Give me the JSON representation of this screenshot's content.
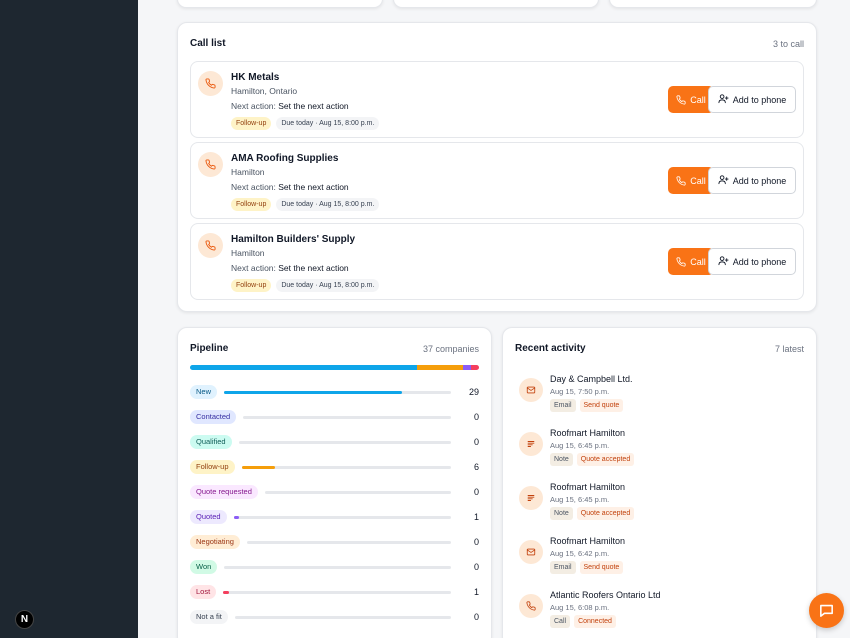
{
  "call_list": {
    "title": "Call list",
    "meta": "3 to call",
    "call_label": "Call",
    "phone_label": "Add to phone",
    "next_prefix": "Next action: ",
    "items": [
      {
        "name": "HK Metals",
        "location": "Hamilton, Ontario",
        "next_action": "Set the next action",
        "tag": "Follow-up",
        "due": "Due today · Aug 15, 8:00 p.m."
      },
      {
        "name": "AMA Roofing Supplies",
        "location": "Hamilton",
        "next_action": "Set the next action",
        "tag": "Follow-up",
        "due": "Due today · Aug 15, 8:00 p.m."
      },
      {
        "name": "Hamilton Builders' Supply",
        "location": "Hamilton",
        "next_action": "Set the next action",
        "tag": "Follow-up",
        "due": "Due today · Aug 15, 8:00 p.m."
      }
    ]
  },
  "pipeline": {
    "title": "Pipeline",
    "meta": "37 companies",
    "total": 37,
    "stages": [
      {
        "label": "New",
        "count": 29,
        "color": "#0ea5e9",
        "bg": "#e0f2fe",
        "fg": "#075985"
      },
      {
        "label": "Contacted",
        "count": 0,
        "color": "#6366f1",
        "bg": "#e0e7ff",
        "fg": "#3730a3"
      },
      {
        "label": "Qualified",
        "count": 0,
        "color": "#14b8a6",
        "bg": "#ccfbf1",
        "fg": "#115e59"
      },
      {
        "label": "Follow-up",
        "count": 6,
        "color": "#f59e0b",
        "bg": "#fef3c7",
        "fg": "#92400e"
      },
      {
        "label": "Quote requested",
        "count": 0,
        "color": "#c026d3",
        "bg": "#fae8ff",
        "fg": "#86198f"
      },
      {
        "label": "Quoted",
        "count": 1,
        "color": "#8b5cf6",
        "bg": "#ede9fe",
        "fg": "#5b21b6"
      },
      {
        "label": "Negotiating",
        "count": 0,
        "color": "#f97316",
        "bg": "#ffedd5",
        "fg": "#9a3412"
      },
      {
        "label": "Won",
        "count": 0,
        "color": "#10b981",
        "bg": "#d1fae5",
        "fg": "#065f46"
      },
      {
        "label": "Lost",
        "count": 1,
        "color": "#f43f5e",
        "bg": "#ffe4e6",
        "fg": "#9f1239"
      },
      {
        "label": "Not a fit",
        "count": 0,
        "color": "#9ca3af",
        "bg": "#f3f4f6",
        "fg": "#374151"
      }
    ]
  },
  "recent_activity": {
    "title": "Recent activity",
    "meta": "7 latest",
    "items": [
      {
        "name": "Day & Campbell Ltd.",
        "time": "Aug 15, 7:50 p.m.",
        "type": "Email",
        "result": "Send quote",
        "icon": "mail-icon"
      },
      {
        "name": "Roofmart Hamilton",
        "time": "Aug 15, 6:45 p.m.",
        "type": "Note",
        "result": "Quote accepted",
        "icon": "note-icon"
      },
      {
        "name": "Roofmart Hamilton",
        "time": "Aug 15, 6:45 p.m.",
        "type": "Note",
        "result": "Quote accepted",
        "icon": "note-icon"
      },
      {
        "name": "Roofmart Hamilton",
        "time": "Aug 15, 6:42 p.m.",
        "type": "Email",
        "result": "Send quote",
        "icon": "mail-icon"
      },
      {
        "name": "Atlantic Roofers Ontario Ltd",
        "time": "Aug 15, 6:08 p.m.",
        "type": "Call",
        "result": "Connected",
        "icon": "phone-icon"
      }
    ]
  },
  "nav_logo": "N",
  "colors": {
    "accent": "#f97316",
    "sidebar": "#1e2730"
  }
}
